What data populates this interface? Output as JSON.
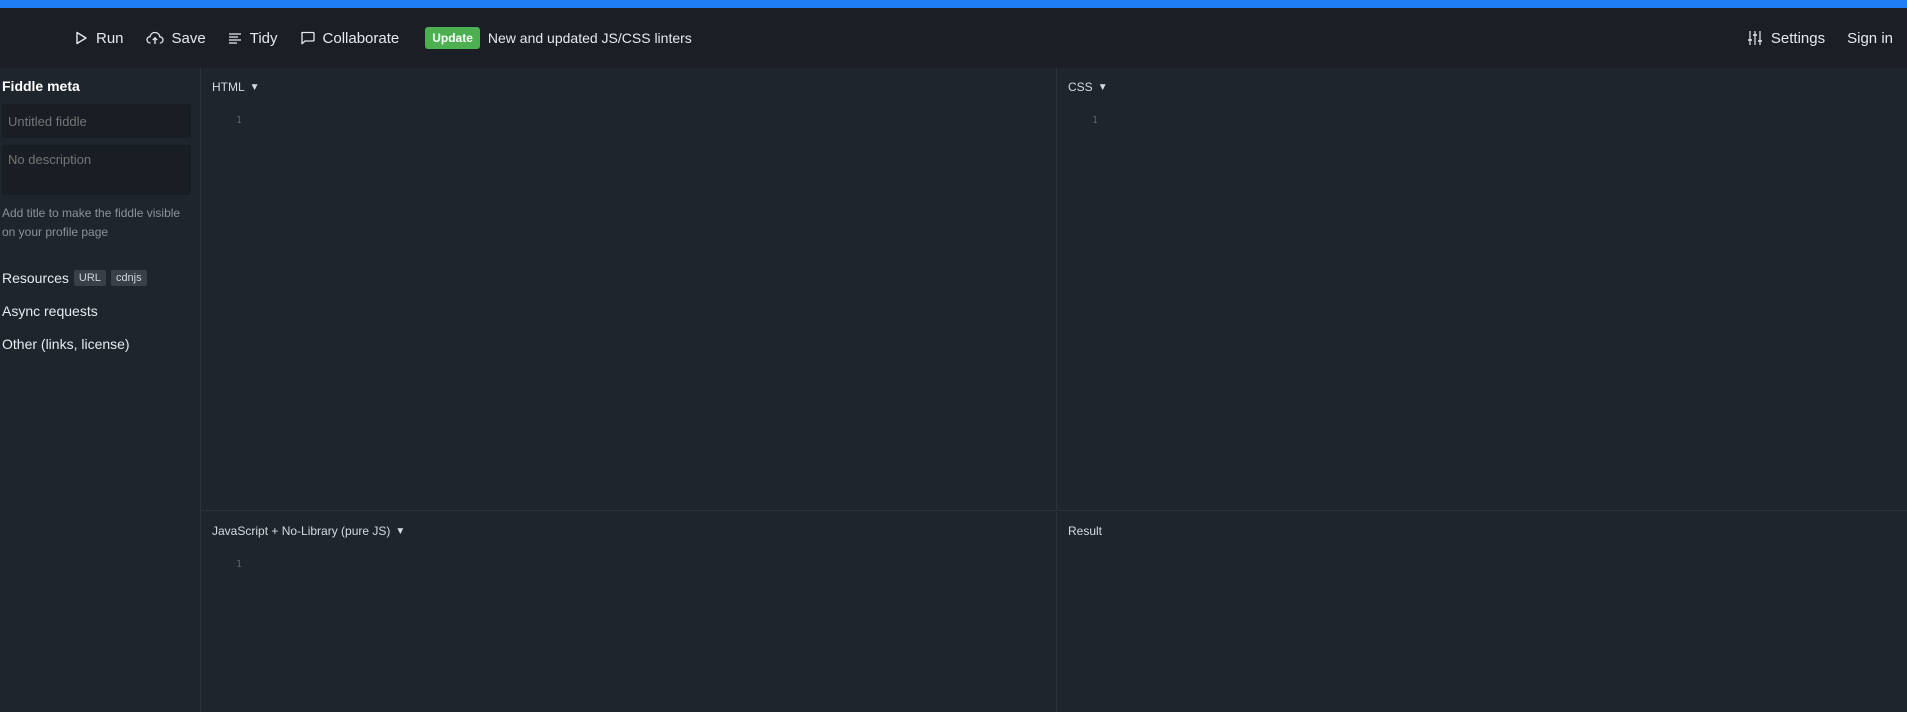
{
  "toolbar": {
    "run_label": "Run",
    "save_label": "Save",
    "tidy_label": "Tidy",
    "collaborate_label": "Collaborate",
    "update_badge": "Update",
    "update_text": "New and updated JS/CSS linters",
    "settings_label": "Settings",
    "signin_label": "Sign in"
  },
  "sidebar": {
    "title": "Fiddle meta",
    "title_placeholder": "Untitled fiddle",
    "description_placeholder": "No description",
    "hint": "Add title to make the fiddle visible on your profile page",
    "resources_label": "Resources",
    "resources_tags": [
      "URL",
      "cdnjs"
    ],
    "async_label": "Async requests",
    "other_label": "Other (links, license)"
  },
  "panes": {
    "html": {
      "label": "HTML",
      "line": "1"
    },
    "css": {
      "label": "CSS",
      "line": "1"
    },
    "js": {
      "label": "JavaScript + No-Library (pure JS)",
      "line": "1"
    },
    "result": {
      "label": "Result"
    }
  },
  "colors": {
    "accent_bar": "#1d7ef5",
    "update_badge": "#4caf50",
    "background": "#1f252d",
    "toolbar": "#1b1f25"
  }
}
